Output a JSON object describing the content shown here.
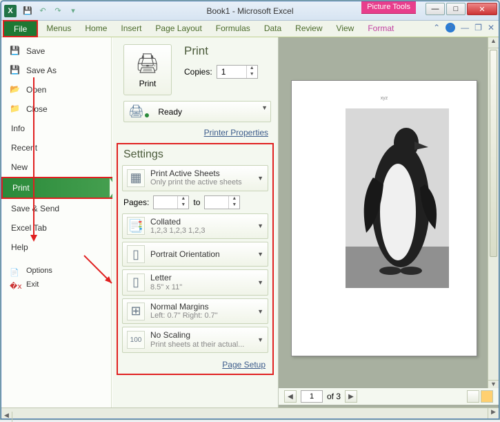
{
  "window": {
    "title": "Book1 - Microsoft Excel",
    "picture_tools": "Picture Tools"
  },
  "ribbon": {
    "file": "File",
    "tabs": [
      "Menus",
      "Home",
      "Insert",
      "Page Layout",
      "Formulas",
      "Data",
      "Review",
      "View"
    ],
    "format": "Format"
  },
  "nav": {
    "save": "Save",
    "save_as": "Save As",
    "open": "Open",
    "close": "Close",
    "info": "Info",
    "recent": "Recent",
    "new": "New",
    "print": "Print",
    "save_send": "Save & Send",
    "excel_tab": "Excel Tab",
    "help": "Help",
    "options": "Options",
    "exit": "Exit"
  },
  "print": {
    "header": "Print",
    "button": "Print",
    "copies_label": "Copies:",
    "copies_value": "1",
    "printer_status": "Ready",
    "printer_props": "Printer Properties"
  },
  "settings": {
    "title": "Settings",
    "active_sheets": {
      "label": "Print Active Sheets",
      "sub": "Only print the active sheets"
    },
    "pages_label": "Pages:",
    "pages_to": "to",
    "collated": {
      "label": "Collated",
      "sub": "1,2,3   1,2,3   1,2,3"
    },
    "orientation": {
      "label": "Portrait Orientation"
    },
    "paper": {
      "label": "Letter",
      "sub": "8.5\" x 11\""
    },
    "margins": {
      "label": "Normal Margins",
      "sub": "Left: 0.7\"   Right: 0.7\""
    },
    "scaling": {
      "label": "No Scaling",
      "sub": "Print sheets at their actual..."
    },
    "page_setup": "Page Setup"
  },
  "preview": {
    "page_current": "1",
    "page_total": "of 3"
  }
}
